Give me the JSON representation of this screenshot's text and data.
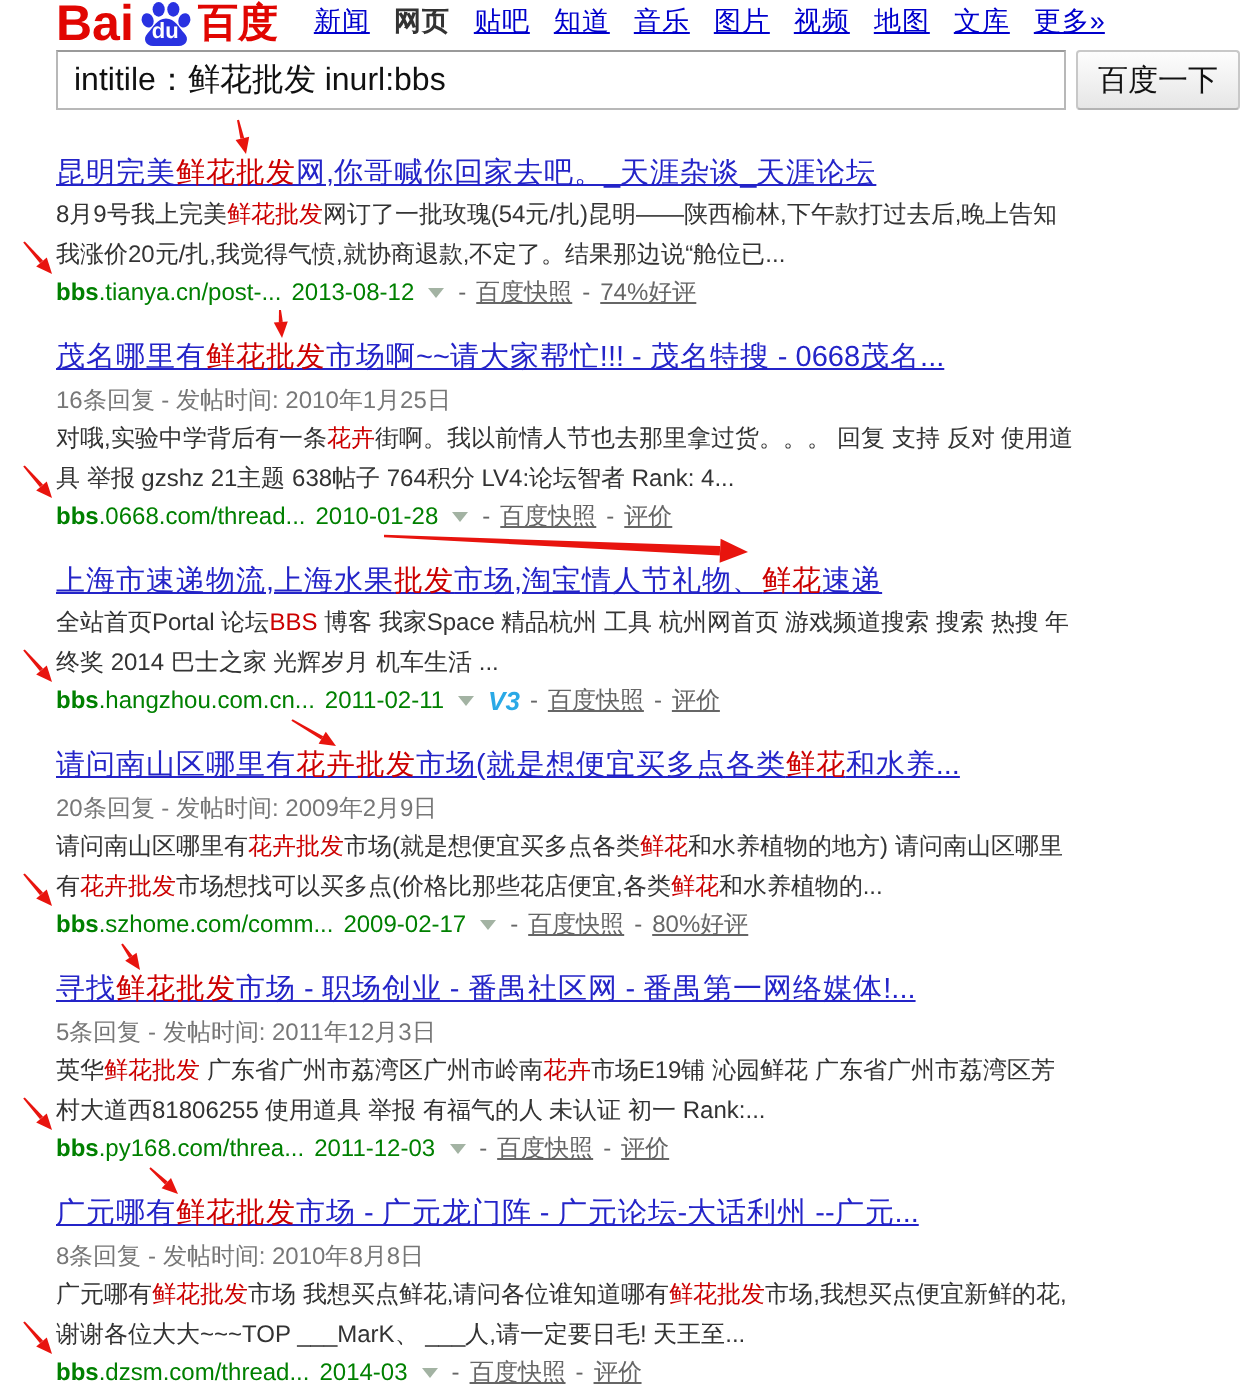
{
  "logo": {
    "left": "Bai",
    "paw": "du",
    "right": "百度"
  },
  "nav": [
    {
      "label": "新闻",
      "selected": false
    },
    {
      "label": "网页",
      "selected": true
    },
    {
      "label": "贴吧",
      "selected": false
    },
    {
      "label": "知道",
      "selected": false
    },
    {
      "label": "音乐",
      "selected": false
    },
    {
      "label": "图片",
      "selected": false
    },
    {
      "label": "视频",
      "selected": false
    },
    {
      "label": "地图",
      "selected": false
    },
    {
      "label": "文库",
      "selected": false
    },
    {
      "label": "更多»",
      "selected": false
    }
  ],
  "search": {
    "value": "intitile：鲜花批发 inurl:bbs",
    "button": "百度一下"
  },
  "results": [
    {
      "title": [
        {
          "text": "昆明完美",
          "highlighted": false
        },
        {
          "text": "鲜花批发",
          "highlighted": true
        },
        {
          "text": "网,你哥喊你回家去吧。_天涯杂谈_天涯论坛",
          "highlighted": false
        }
      ],
      "snippet": [
        {
          "text": "8月9号我上完美",
          "highlighted": false
        },
        {
          "text": "鲜花批发",
          "highlighted": true
        },
        {
          "text": "网订了一批玫瑰(54元/扎)昆明——陕西榆林,下午款打过去后,晚上告知我涨价20元/扎,我觉得气愤,就协商退款,不定了。结果那边说“舱位已...",
          "highlighted": false
        }
      ],
      "url_line": [
        {
          "kind": "url",
          "text": "**bbs**.tianya.cn/post-..."
        },
        {
          "kind": "date",
          "text": "2013-08-12"
        },
        {
          "kind": "caret"
        },
        {
          "kind": "separator",
          "text": "-"
        },
        {
          "kind": "snapshot",
          "text": "百度快照"
        },
        {
          "kind": "separator",
          "text": "-"
        },
        {
          "kind": "rating",
          "text": "74%好评"
        }
      ]
    },
    {
      "title": [
        {
          "text": "茂名哪里有",
          "highlighted": false
        },
        {
          "text": "鲜花批发",
          "highlighted": true
        },
        {
          "text": "市场啊~~请大家帮忙!!! - 茂名特搜 - 0668茂名...",
          "highlighted": false
        }
      ],
      "meta": "16条回复 - 发帖时间: 2010年1月25日",
      "snippet": [
        {
          "text": "对哦,实验中学背后有一条",
          "highlighted": false
        },
        {
          "text": "花卉",
          "highlighted": true
        },
        {
          "text": "街啊。我以前情人节也去那里拿过货。。。 回复 支持 反对 使用道具 举报 gzshz 21主题 638帖子 764积分 LV4:论坛智者 Rank: 4...",
          "highlighted": false
        }
      ],
      "url_line": [
        {
          "kind": "url",
          "text": "**bbs**.0668.com/thread..."
        },
        {
          "kind": "date",
          "text": "2010-01-28"
        },
        {
          "kind": "caret"
        },
        {
          "kind": "separator",
          "text": "-"
        },
        {
          "kind": "snapshot",
          "text": "百度快照"
        },
        {
          "kind": "separator",
          "text": "-"
        },
        {
          "kind": "rating",
          "text": "评价"
        }
      ]
    },
    {
      "title": [
        {
          "text": "上海市速递物流,上海水果",
          "highlighted": false
        },
        {
          "text": "批发",
          "highlighted": true
        },
        {
          "text": "市场,淘宝情人节礼物、",
          "highlighted": false
        },
        {
          "text": "鲜花",
          "highlighted": true
        },
        {
          "text": "速递",
          "highlighted": false
        }
      ],
      "snippet": [
        {
          "text": "全站首页Portal 论坛",
          "highlighted": false
        },
        {
          "text": "BBS",
          "highlighted": true
        },
        {
          "text": " 博客 我家Space 精品杭州 工具 杭州网首页 游戏频道搜索 搜索 热搜 年终奖 2014 巴士之家 光辉岁月 机车生活 ...",
          "highlighted": false
        }
      ],
      "url_line": [
        {
          "kind": "url",
          "text": "**bbs**.hangzhou.com.cn..."
        },
        {
          "kind": "date",
          "text": "2011-02-11"
        },
        {
          "kind": "caret"
        },
        {
          "kind": "badge",
          "text": "V3"
        },
        {
          "kind": "separator",
          "text": "-"
        },
        {
          "kind": "snapshot",
          "text": "百度快照"
        },
        {
          "kind": "separator",
          "text": "-"
        },
        {
          "kind": "rating",
          "text": "评价"
        }
      ]
    },
    {
      "title": [
        {
          "text": "请问南山区哪里有",
          "highlighted": false
        },
        {
          "text": "花卉批发",
          "highlighted": true
        },
        {
          "text": "市场(就是想便宜买多点各类",
          "highlighted": false
        },
        {
          "text": "鲜花",
          "highlighted": true
        },
        {
          "text": "和水养...",
          "highlighted": false
        }
      ],
      "meta": "20条回复 - 发帖时间: 2009年2月9日",
      "snippet": [
        {
          "text": "请问南山区哪里有",
          "highlighted": false
        },
        {
          "text": "花卉批发",
          "highlighted": true
        },
        {
          "text": "市场(就是想便宜买多点各类",
          "highlighted": false
        },
        {
          "text": "鲜花",
          "highlighted": true
        },
        {
          "text": "和水养植物的地方) 请问南山区哪里有",
          "highlighted": false
        },
        {
          "text": "花卉批发",
          "highlighted": true
        },
        {
          "text": "市场想找可以买多点(价格比那些花店便宜,各类",
          "highlighted": false
        },
        {
          "text": "鲜花",
          "highlighted": true
        },
        {
          "text": "和水养植物的...",
          "highlighted": false
        }
      ],
      "url_line": [
        {
          "kind": "url",
          "text": "**bbs**.szhome.com/comm..."
        },
        {
          "kind": "date",
          "text": "2009-02-17"
        },
        {
          "kind": "caret"
        },
        {
          "kind": "separator",
          "text": "-"
        },
        {
          "kind": "snapshot",
          "text": "百度快照"
        },
        {
          "kind": "separator",
          "text": "-"
        },
        {
          "kind": "rating",
          "text": "80%好评"
        }
      ]
    },
    {
      "title": [
        {
          "text": "寻找",
          "highlighted": false
        },
        {
          "text": "鲜花批发",
          "highlighted": true
        },
        {
          "text": "市场 - 职场创业 - 番禺社区网 - 番禺第一网络媒体!...",
          "highlighted": false
        }
      ],
      "meta": "5条回复 - 发帖时间: 2011年12月3日",
      "snippet": [
        {
          "text": "英华",
          "highlighted": false
        },
        {
          "text": "鲜花批发",
          "highlighted": true
        },
        {
          "text": " 广东省广州市荔湾区广州市岭南",
          "highlighted": false
        },
        {
          "text": "花卉",
          "highlighted": true
        },
        {
          "text": "市场E19铺 沁园鲜花 广东省广州市荔湾区芳村大道西81806255 使用道具 举报 有福气的人 未认证 初一 Rank:...",
          "highlighted": false
        }
      ],
      "url_line": [
        {
          "kind": "url",
          "text": "**bbs**.py168.com/threa..."
        },
        {
          "kind": "date",
          "text": "2011-12-03"
        },
        {
          "kind": "caret"
        },
        {
          "kind": "separator",
          "text": "-"
        },
        {
          "kind": "snapshot",
          "text": "百度快照"
        },
        {
          "kind": "separator",
          "text": "-"
        },
        {
          "kind": "rating",
          "text": "评价"
        }
      ]
    },
    {
      "title": [
        {
          "text": "广元哪有",
          "highlighted": false
        },
        {
          "text": "鲜花批发",
          "highlighted": true
        },
        {
          "text": "市场 - 广元龙门阵 - 广元论坛-大话利州 --广元...",
          "highlighted": false
        }
      ],
      "meta": "8条回复 - 发帖时间: 2010年8月8日",
      "snippet": [
        {
          "text": "广元哪有",
          "highlighted": false
        },
        {
          "text": "鲜花批发",
          "highlighted": true
        },
        {
          "text": "市场 我想买点鲜花,请问各位谁知道哪有",
          "highlighted": false
        },
        {
          "text": "鲜花批发",
          "highlighted": true
        },
        {
          "text": "市场,我想买点便宜新鲜的花,谢谢各位大大~~~TOP ___MarK、 ___人,请一定要日毛! 天王至...",
          "highlighted": false
        }
      ],
      "url_line": [
        {
          "kind": "url",
          "text": "**bbs**.dzsm.com/thread..."
        },
        {
          "kind": "date",
          "text": "2014-03"
        },
        {
          "kind": "caret"
        },
        {
          "kind": "separator",
          "text": "-"
        },
        {
          "kind": "snapshot",
          "text": "百度快照"
        },
        {
          "kind": "separator",
          "text": "-"
        },
        {
          "kind": "rating",
          "text": "评价"
        }
      ]
    }
  ]
}
